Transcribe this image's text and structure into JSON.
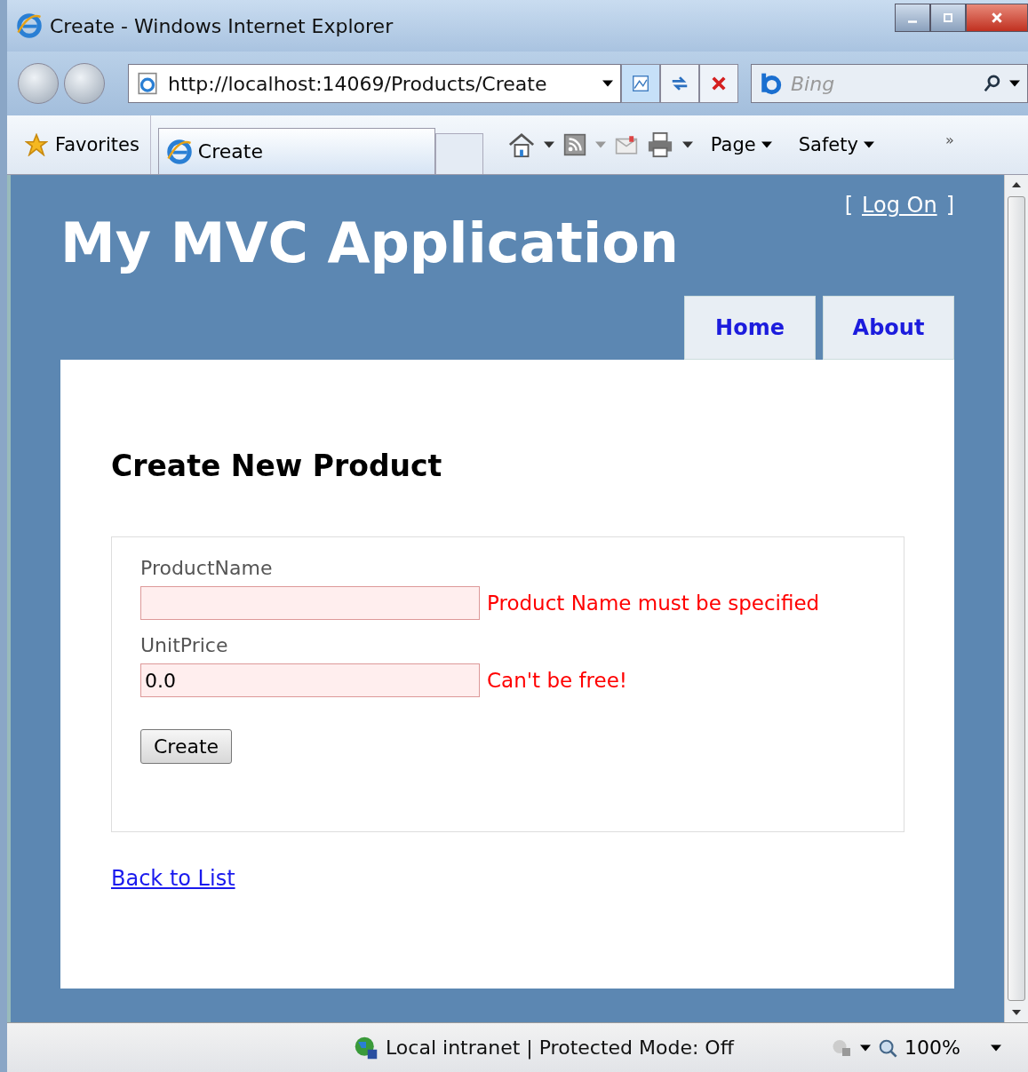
{
  "window": {
    "title": "Create - Windows Internet Explorer"
  },
  "address_bar": {
    "url": "http://localhost:14069/Products/Create"
  },
  "search": {
    "placeholder": "Bing"
  },
  "favorites": {
    "label": "Favorites"
  },
  "browser_tab": {
    "label": "Create"
  },
  "command_bar": {
    "items": [
      {
        "label": "Page"
      },
      {
        "label": "Safety"
      }
    ],
    "overflow": "»"
  },
  "page": {
    "site_title": "My MVC Application",
    "login": {
      "open": "[",
      "link": "Log On",
      "close": "]"
    },
    "menu": [
      {
        "label": "Home"
      },
      {
        "label": "About"
      }
    ],
    "heading": "Create New Product",
    "fields": [
      {
        "label": "ProductName",
        "invalid": true,
        "error": "Product Name must be specified"
      },
      {
        "label": "UnitPrice",
        "value": "0.0",
        "invalid": true,
        "error": "Can't be free!"
      }
    ],
    "submit": "Create",
    "back_link": "Back to List"
  },
  "status_bar": {
    "zone": "Local intranet | Protected Mode: Off",
    "zoom": "100%"
  }
}
